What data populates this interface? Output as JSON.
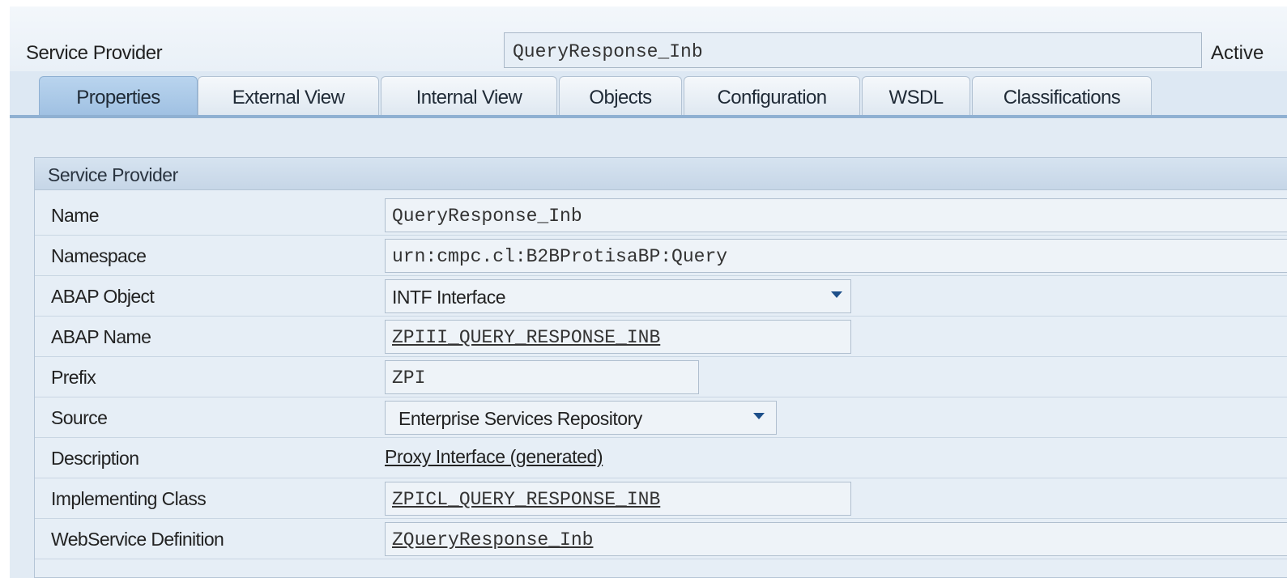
{
  "header": {
    "label": "Service Provider",
    "value": "QueryResponse_Inb",
    "status": "Active"
  },
  "tabs": [
    {
      "label": "Properties",
      "active": true
    },
    {
      "label": "External View",
      "active": false
    },
    {
      "label": "Internal View",
      "active": false
    },
    {
      "label": "Objects",
      "active": false
    },
    {
      "label": "Configuration",
      "active": false
    },
    {
      "label": "WSDL",
      "active": false
    },
    {
      "label": "Classifications",
      "active": false
    }
  ],
  "group": {
    "title": "Service Provider",
    "fields": {
      "name": {
        "label": "Name",
        "value": "QueryResponse_Inb"
      },
      "namespace": {
        "label": "Namespace",
        "value": "urn:cmpc.cl:B2BProtisaBP:Query"
      },
      "abap_object": {
        "label": "ABAP Object",
        "value": "INTF Interface"
      },
      "abap_name": {
        "label": "ABAP Name",
        "value": "ZPIII_QUERY_RESPONSE_INB"
      },
      "prefix": {
        "label": "Prefix",
        "value": "ZPI"
      },
      "source": {
        "label": "Source",
        "value": "Enterprise Services Repository"
      },
      "description": {
        "label": "Description",
        "value": "Proxy Interface (generated)"
      },
      "implementing_class": {
        "label": "Implementing Class",
        "value": "ZPICL_QUERY_RESPONSE_INB"
      },
      "webservice_definition": {
        "label": "WebService Definition",
        "value": "ZQueryResponse_Inb"
      }
    }
  },
  "colors": {
    "active_tab": "#a9c8e8",
    "panel_bg": "#e6eef6",
    "dropdown_arrow": "#1d4f8a"
  }
}
